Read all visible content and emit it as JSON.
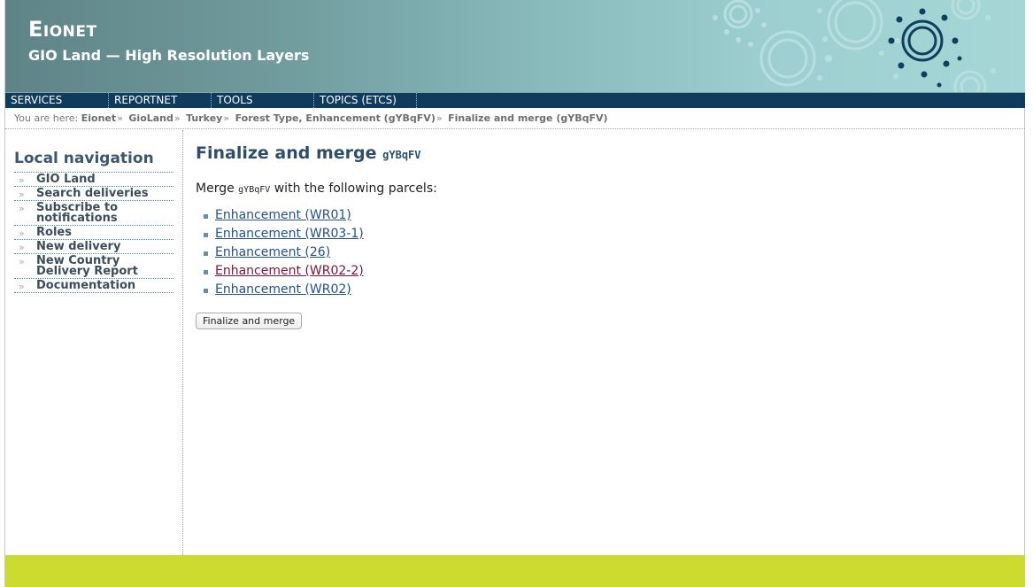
{
  "header": {
    "brand_big": "E",
    "brand_rest": "IONET",
    "subtitle": "GIO Land — High Resolution Layers"
  },
  "topnav": [
    {
      "label": "SERVICES"
    },
    {
      "label": "REPORTNET"
    },
    {
      "label": "TOOLS"
    },
    {
      "label": "TOPICS (ETCS)"
    }
  ],
  "breadcrumb": {
    "prefix": "You are here:",
    "items": [
      "Eionet",
      "GioLand",
      "Turkey",
      "Forest Type, Enhancement (gYBqFV)",
      "Finalize and merge (gYBqFV)"
    ]
  },
  "localnav": {
    "title": "Local navigation",
    "items": [
      {
        "label": "GIO Land"
      },
      {
        "label": "Search deliveries"
      },
      {
        "label": "Subscribe to notifications"
      },
      {
        "label": "Roles"
      },
      {
        "label": "New delivery"
      },
      {
        "label": "New Country Delivery Report"
      },
      {
        "label": "Documentation"
      }
    ]
  },
  "main": {
    "title": "Finalize and merge",
    "title_code": "gYBqFV",
    "intro_before": "Merge",
    "intro_code": "gYBqFV",
    "intro_after": "with the following parcels:",
    "parcels": [
      {
        "label": "Enhancement (WR01)"
      },
      {
        "label": "Enhancement (WR03-1)"
      },
      {
        "label": "Enhancement (26)"
      },
      {
        "label": "Enhancement (WR02-2)"
      },
      {
        "label": "Enhancement (WR02)"
      }
    ],
    "button_label": "Finalize and merge"
  },
  "colors": {
    "navbar": "#0f3b5c",
    "footer": "#ccdb2f",
    "link": "#24508c",
    "visited_link": "#7a1438"
  }
}
